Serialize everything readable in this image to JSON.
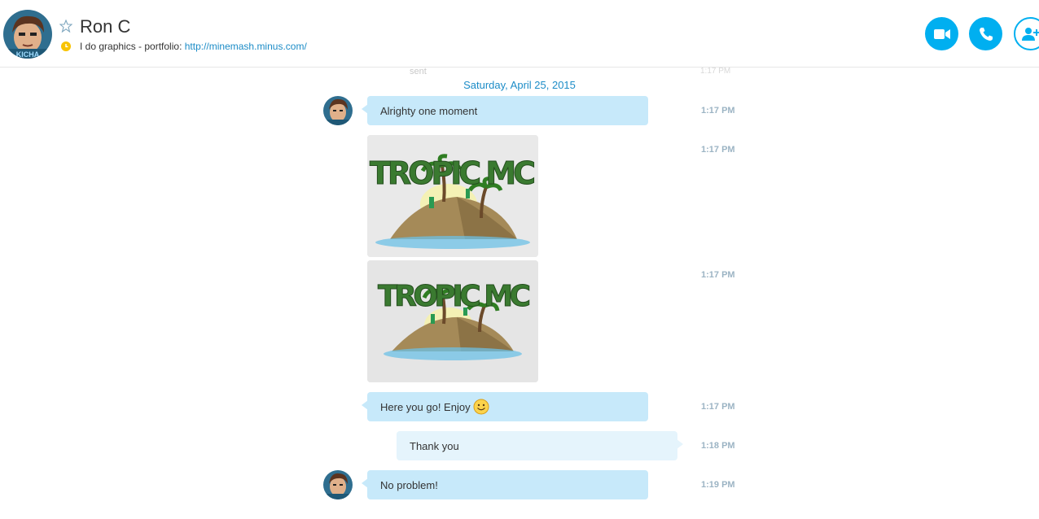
{
  "contact": {
    "name": "Ron C",
    "mood_text": "I do graphics - portfolio: ",
    "mood_link": "http://minemash.minus.com/",
    "avatar_badge": "KICHA"
  },
  "header_buttons": {
    "video": "video-call-icon",
    "call": "phone-icon",
    "add": "add-contact-icon"
  },
  "ghost": {
    "sent": "sent",
    "time": "1:17 PM"
  },
  "date_divider": "Saturday, April 25, 2015",
  "messages": [
    {
      "type": "text",
      "from": "contact",
      "text": "Alrighty one moment",
      "time": "1:17 PM"
    },
    {
      "type": "image",
      "from": "contact",
      "caption": "TROPIC MC",
      "time": "1:17 PM"
    },
    {
      "type": "image",
      "from": "contact",
      "caption": "TROPIC MC",
      "time": "1:17 PM"
    },
    {
      "type": "text",
      "from": "contact",
      "text": "Here you go! Enjoy",
      "emoticon": "smile",
      "time": "1:17 PM"
    },
    {
      "type": "text",
      "from": "me",
      "text": "Thank you",
      "time": "1:18 PM"
    },
    {
      "type": "text",
      "from": "contact",
      "text": "No problem!",
      "time": "1:19 PM"
    }
  ],
  "colors": {
    "accent": "#00aff0",
    "link": "#1c8cc7",
    "incoming_bubble": "#c7e9fa",
    "outgoing_bubble": "#e5f4fc",
    "timestamp": "#9cb4c4"
  }
}
